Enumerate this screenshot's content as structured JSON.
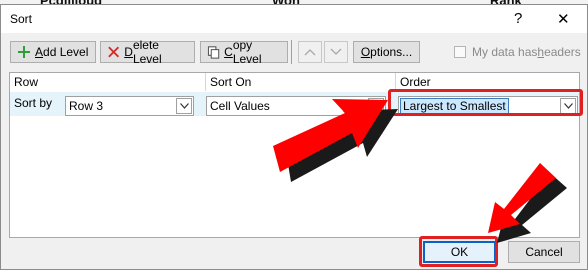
{
  "background_peek": [
    "Pcdlilloud",
    "Won",
    "Rank"
  ],
  "window": {
    "title": "Sort",
    "help_icon": "?",
    "close_icon": "✕"
  },
  "toolbar": {
    "add_level": {
      "accel": "A",
      "rest": "dd Level",
      "icon": "plus-icon"
    },
    "delete_level": {
      "accel": "D",
      "rest": "elete Level",
      "icon": "delete-x-icon"
    },
    "copy_level": {
      "accel": "C",
      "rest": "opy Level",
      "icon": "copy-icon"
    },
    "move_up_icon": "chevron-up-icon",
    "move_down_icon": "chevron-down-icon",
    "options": {
      "accel": "O",
      "rest": "ptions..."
    },
    "my_data_has_headers": {
      "pre": "My data has ",
      "accel": "h",
      "rest": "eaders",
      "checked": false
    }
  },
  "grid": {
    "headers": [
      "Row",
      "Sort On",
      "Order"
    ],
    "rows": [
      {
        "label": "Sort by",
        "row": "Row 3",
        "sort_on": "Cell Values",
        "order": "Largest to Smallest"
      }
    ]
  },
  "buttons": {
    "ok": "OK",
    "cancel": "Cancel"
  },
  "colors": {
    "annotation_red": "#ff0000",
    "ok_focus_blue": "#0a62c9",
    "selected_row": "#e5f3fb"
  }
}
